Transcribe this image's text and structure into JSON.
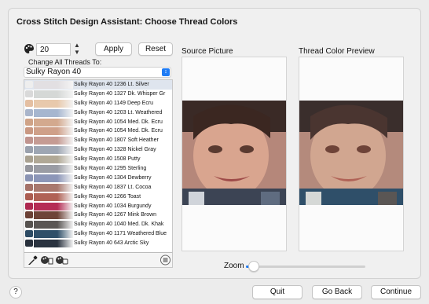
{
  "window": {
    "title": "Cross Stitch Design Assistant: Choose Thread Colors"
  },
  "controls": {
    "thread_count": "20",
    "apply_label": "Apply",
    "reset_label": "Reset",
    "change_all_label": "Change All Threads To:",
    "thread_brand": "Sulky Rayon 40"
  },
  "threads": [
    {
      "label": "Sulky Rayon 40 1236 Lt. Silver",
      "swatch": "#e2dfe2",
      "chk": "#eeeeee"
    },
    {
      "label": "Sulky Rayon 40 1327 Dk. Whisper Gr",
      "swatch": "#d5d8d6",
      "chk": "#d9d9d9"
    },
    {
      "label": "Sulky Rayon 40 1149 Deep Ecru",
      "swatch": "#e8c9ac",
      "chk": "#e4bfa2"
    },
    {
      "label": "Sulky Rayon 40 1203 Lt. Weathered",
      "swatch": "#a6b6cf",
      "chk": "#a9b5cb"
    },
    {
      "label": "Sulky Rayon 40 1054 Med. Dk. Ecru",
      "swatch": "#d3a98e",
      "chk": "#cfa387"
    },
    {
      "label": "Sulky Rayon 40 1054 Med. Dk. Ecru",
      "swatch": "#cfa089",
      "chk": "#c99882"
    },
    {
      "label": "Sulky Rayon 40 1807 Soft Heather",
      "swatch": "#c59b93",
      "chk": "#c0948e"
    },
    {
      "label": "Sulky Rayon 40 1328 Nickel Gray",
      "swatch": "#9ea6b3",
      "chk": "#9aa1ad"
    },
    {
      "label": "Sulky Rayon 40 1508 Putty",
      "swatch": "#b0a896",
      "chk": "#a9a190"
    },
    {
      "label": "Sulky Rayon 40 1295 Sterling",
      "swatch": "#9a9ca4",
      "chk": "#95969d"
    },
    {
      "label": "Sulky Rayon 40 1304 Dewberry",
      "swatch": "#8c96b8",
      "chk": "#8a93b3"
    },
    {
      "label": "Sulky Rayon 40 1837 Lt. Cocoa",
      "swatch": "#a8786e",
      "chk": "#a57268"
    },
    {
      "label": "Sulky Rayon 40 1266 Toast",
      "swatch": "#b06256",
      "chk": "#ab5c50"
    },
    {
      "label": "Sulky Rayon 40 1034 Burgundy",
      "swatch": "#b52c55",
      "chk": "#ae2850"
    },
    {
      "label": "Sulky Rayon 40 1267 Mink Brown",
      "swatch": "#6e4338",
      "chk": "#6b4035"
    },
    {
      "label": "Sulky Rayon 40 1040 Med. Dk. Khak",
      "swatch": "#5a5654",
      "chk": "#56524f"
    },
    {
      "label": "Sulky Rayon 40 1171 Weathered Blue",
      "swatch": "#2f4f69",
      "chk": "#2d4b64"
    },
    {
      "label": "Sulky Rayon 40 643 Arctic Sky",
      "swatch": "#2a3340",
      "chk": "#28303c"
    }
  ],
  "panels": {
    "source_label": "Source Picture",
    "preview_label": "Thread Color Preview"
  },
  "zoom": {
    "label": "Zoom",
    "level": 0.02
  },
  "footer": {
    "help_label": "?",
    "quit_label": "Quit",
    "back_label": "Go Back",
    "continue_label": "Continue"
  },
  "colors": {
    "accent": "#1f7cf5",
    "selected_row": "#dfe5ee"
  }
}
